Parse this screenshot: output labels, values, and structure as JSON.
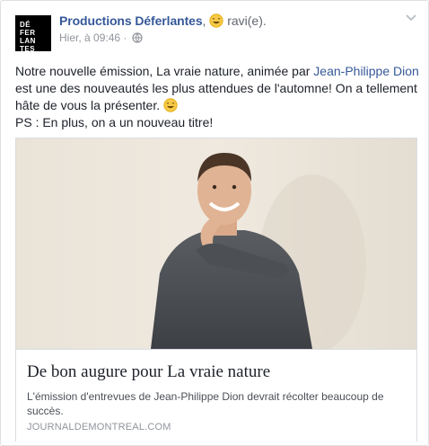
{
  "post": {
    "page_name": "Productions Déferlantes",
    "feeling": "ravi(e).",
    "timestamp": "Hier, à 09:46",
    "separator": "·",
    "avatar_rows": [
      "DÉ",
      "FER",
      "LAN",
      "TES"
    ],
    "body": {
      "part1": "Notre nouvelle émission, La vraie nature, animée par ",
      "mention": "Jean-Philippe Dion",
      "part2": " est une des nouveautés les plus attendues de l'automne! On a tellement hâte de vous la présenter. ",
      "line2": "PS : En plus, on a un nouveau titre!"
    }
  },
  "link_card": {
    "title": "De bon augure pour La vraie nature",
    "description": "L'émission d'entrevues de Jean-Philippe Dion devrait récolter beaucoup de succès.",
    "source": "JOURNALDEMONTREAL.COM"
  },
  "colors": {
    "link_blue": "#365899",
    "secondary_text": "#90949c",
    "border": "#dddfe2"
  },
  "icons": [
    "chevron-down-icon",
    "globe-icon",
    "grinning-emoji-icon"
  ]
}
